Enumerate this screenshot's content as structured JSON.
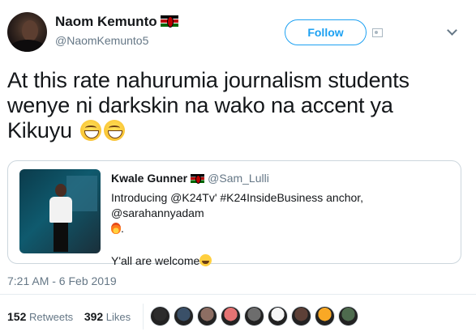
{
  "author": {
    "name": "Naom Kemunto",
    "handle": "@NaomKemunto5",
    "flag": "kenya-flag-icon"
  },
  "actions": {
    "follow_label": "Follow"
  },
  "tweet": {
    "text": "At this rate nahurumia journalism students wenye ni darkskin  na wako na accent ya Kikuyu",
    "emojis": [
      "grinning-face-icon",
      "grinning-face-icon"
    ],
    "timestamp": "7:21 AM - 6 Feb 2019"
  },
  "quoted": {
    "name": "Kwale Gunner",
    "handle": "@Sam_Lulli",
    "line1": "Introducing @K24Tv' #K24InsideBusiness anchor, @sarahannyadam",
    "line1_end": ".",
    "line2": "Y'all are welcome"
  },
  "stats": {
    "retweets_count": "152",
    "retweets_label": "Retweets",
    "likes_count": "392",
    "likes_label": "Likes"
  },
  "colors": {
    "accent": "#1da1f2",
    "secondary_text": "#657786",
    "border": "#ccd6dd"
  },
  "likers": [
    "#2c2c2c",
    "#3a5068",
    "#8d6e63",
    "#e57373",
    "#6d6d6d",
    "#f5f5f5",
    "#5d4037",
    "#f9a825",
    "#4e6b4e"
  ]
}
